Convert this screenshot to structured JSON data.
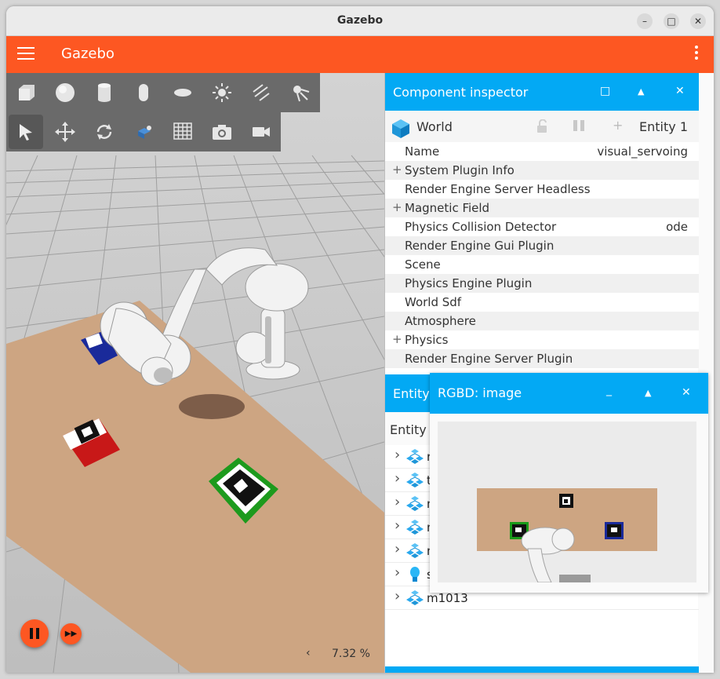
{
  "window": {
    "title": "Gazebo",
    "controls": {
      "minimize": "–",
      "maximize": "□",
      "close": "✕"
    }
  },
  "appbar": {
    "title": "Gazebo"
  },
  "colors": {
    "accent": "#fd5722",
    "panel": "#03a9f4"
  },
  "toolbar": {
    "shapes": [
      "box-icon",
      "sphere-icon",
      "cylinder-icon",
      "capsule-icon",
      "ellipsoid-icon",
      "sun-light-icon",
      "directional-light-icon",
      "spot-light-icon"
    ],
    "tools": [
      "select-arrow-icon",
      "translate-icon",
      "rotate-icon",
      "transform-control-icon",
      "grid-icon",
      "camera-icon",
      "video-record-icon"
    ]
  },
  "sim": {
    "real_time_factor": "7.32 %",
    "arrow": "‹"
  },
  "inspector": {
    "title": "Component inspector",
    "controls": {
      "maximize": "□",
      "up": "▲",
      "close": "✕"
    },
    "entity_name": "World",
    "entity_id": "Entity 1",
    "plus": "+",
    "properties": [
      {
        "label": "Name",
        "value": "visual_servoing",
        "expandable": false
      },
      {
        "label": "System Plugin Info",
        "value": "",
        "expandable": true
      },
      {
        "label": "Render Engine Server Headless",
        "value": "",
        "expandable": false
      },
      {
        "label": "Magnetic Field",
        "value": "",
        "expandable": true
      },
      {
        "label": "Physics Collision Detector",
        "value": "ode",
        "expandable": false
      },
      {
        "label": "Render Engine Gui Plugin",
        "value": "",
        "expandable": false
      },
      {
        "label": "Scene",
        "value": "",
        "expandable": false
      },
      {
        "label": "Physics Engine Plugin",
        "value": "",
        "expandable": false
      },
      {
        "label": "World Sdf",
        "value": "",
        "expandable": false
      },
      {
        "label": "Atmosphere",
        "value": "",
        "expandable": false
      },
      {
        "label": "Physics",
        "value": "",
        "expandable": true
      },
      {
        "label": "Render Engine Server Plugin",
        "value": "",
        "expandable": false
      }
    ]
  },
  "entity_tree": {
    "title": "Entity",
    "subtitle": "Entity T",
    "items": [
      {
        "label": "rg",
        "icon": "model-icon"
      },
      {
        "label": "ta",
        "icon": "model-icon"
      },
      {
        "label": "m",
        "icon": "model-icon"
      },
      {
        "label": "m",
        "icon": "model-icon"
      },
      {
        "label": "m",
        "icon": "model-icon"
      },
      {
        "label": "su",
        "icon": "light-bulb-icon"
      },
      {
        "label": "m1013",
        "icon": "model-icon"
      }
    ]
  },
  "rgbd": {
    "title": "RGBD: image",
    "controls": {
      "minimize": "_",
      "up": "▲",
      "close": "✕"
    }
  }
}
